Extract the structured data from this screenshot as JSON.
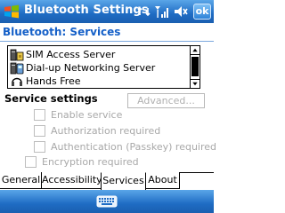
{
  "title_bar": {
    "title": "Bluetooth Settings",
    "ok_label": "ok",
    "colors": {
      "bar": "#1f6cc4",
      "text": "#ffffff"
    }
  },
  "header": {
    "title": "Bluetooth: Services",
    "color": "#1560c8"
  },
  "services": {
    "items": [
      {
        "label": "SIM Access Server",
        "icon": "sim-server-icon"
      },
      {
        "label": "Dial-up Networking Server",
        "icon": "dialup-server-icon"
      },
      {
        "label": "Hands Free",
        "icon": "headset-icon"
      }
    ]
  },
  "service_settings": {
    "label": "Service settings",
    "advanced_label": "Advanced...",
    "options": [
      {
        "label": "Enable service",
        "checked": false,
        "enabled": false
      },
      {
        "label": "Authorization required",
        "checked": false,
        "enabled": false
      },
      {
        "label": "Authentication (Passkey) required",
        "checked": false,
        "enabled": false
      },
      {
        "label": "Encryption required",
        "checked": false,
        "enabled": false
      }
    ]
  },
  "tabs": [
    {
      "label": "General",
      "active": false
    },
    {
      "label": "Accessibility",
      "active": false
    },
    {
      "label": "Services",
      "active": true
    },
    {
      "label": "About",
      "active": false
    }
  ],
  "bottom_bar": {
    "icon": "keyboard-icon"
  }
}
